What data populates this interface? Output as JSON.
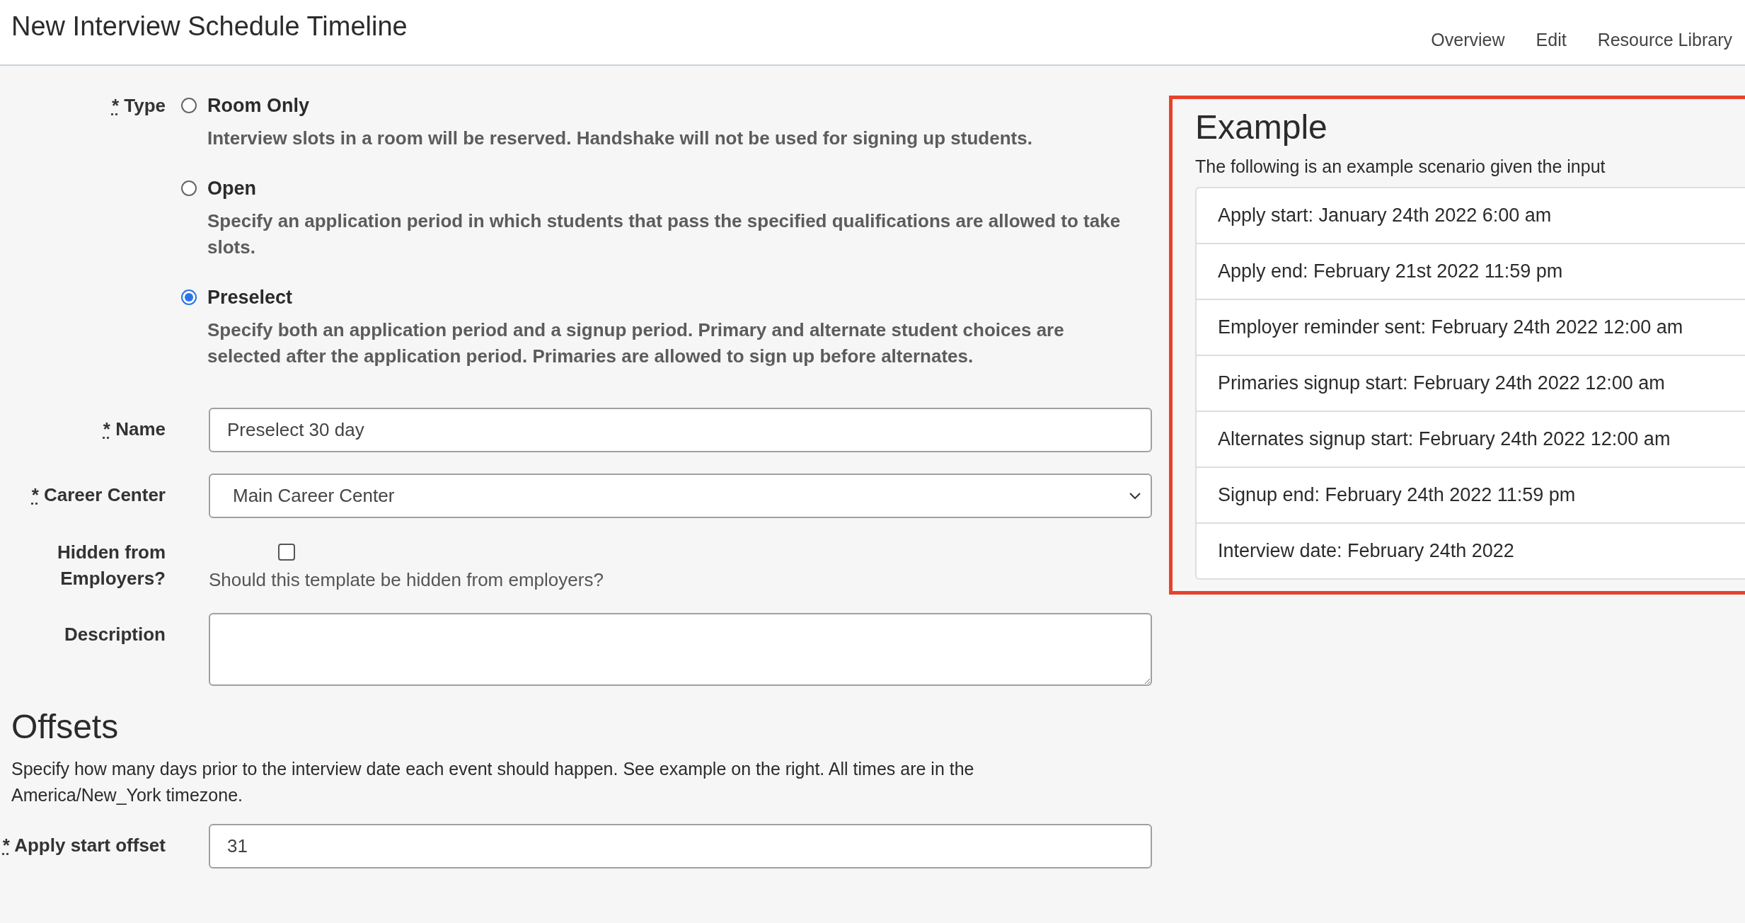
{
  "header": {
    "title": "New Interview Schedule Timeline",
    "nav": [
      {
        "label": "Overview"
      },
      {
        "label": "Edit"
      },
      {
        "label": "Resource Library"
      }
    ]
  },
  "fields": [
    {
      "kind": "radio",
      "label": "Type",
      "required_mark": "*",
      "options": [
        {
          "label": "Room Only",
          "description": "Interview slots in a room will be reserved. Handshake will not be used for signing up students.",
          "selected": false
        },
        {
          "label": "Open",
          "description": "Specify an application period in which students that pass the specified qualifications are allowed to take slots.",
          "selected": false
        },
        {
          "label": "Preselect",
          "description": "Specify both an application period and a signup period. Primary and alternate student choices are selected after the application period. Primaries are allowed to sign up before alternates.",
          "selected": true
        }
      ]
    },
    {
      "kind": "text",
      "label": "Name",
      "required_mark": "*",
      "value": "Preselect 30 day"
    },
    {
      "kind": "select",
      "label": "Career Center",
      "required_mark": "*",
      "value": "Main Career Center"
    },
    {
      "kind": "checkbox",
      "label": "Hidden from Employers?",
      "checked": false,
      "help": "Should this template be hidden from employers?"
    },
    {
      "kind": "textarea",
      "label": "Description"
    }
  ],
  "offsets": {
    "title": "Offsets",
    "intro": "Specify how many days prior to the interview date each event should happen. See example on the right. All times are in the America/New_York timezone.",
    "fields": [
      {
        "kind": "text",
        "label": "Apply start offset",
        "required_mark": "*",
        "value": "31"
      }
    ]
  },
  "example": {
    "title": "Example",
    "subtitle": "The following is an example scenario given the input",
    "items": [
      "Apply start: January 24th 2022 6:00 am",
      "Apply end: February 21st 2022 11:59 pm",
      "Employer reminder sent: February 24th 2022 12:00 am",
      "Primaries signup start: February 24th 2022 12:00 am",
      "Alternates signup start: February 24th 2022 12:00 am",
      "Signup end: February 24th 2022 11:59 pm",
      "Interview date: February 24th 2022"
    ]
  }
}
